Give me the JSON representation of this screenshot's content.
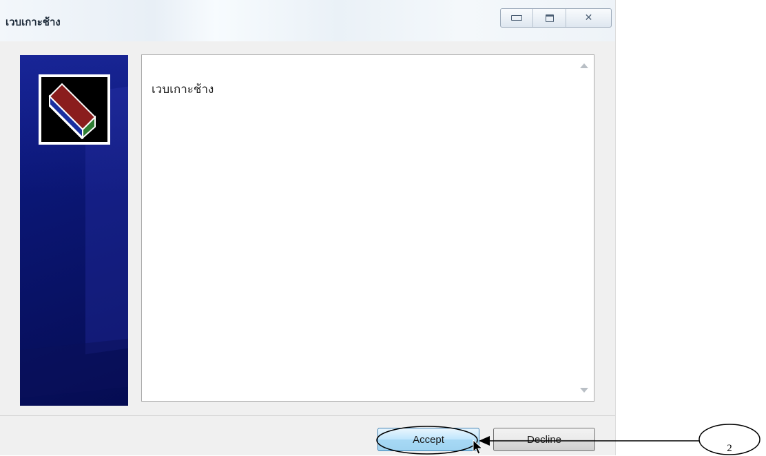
{
  "window": {
    "title": "เวบเกาะช้าง",
    "caption_buttons": [
      "minimize-icon",
      "maximize-icon",
      "close-icon"
    ]
  },
  "content": {
    "text": "เวบเกาะช้าง"
  },
  "buttons": {
    "accept_label": "Accept",
    "decline_label": "Decline"
  },
  "annotation": {
    "callout_number": "2"
  },
  "colors": {
    "side_panel": "#0a1570",
    "accept_button": "#bee6fd",
    "logo_top_face": "#8a1d1d",
    "logo_side_face": "#2e7d32",
    "logo_front_face": "#1a2fa0"
  }
}
